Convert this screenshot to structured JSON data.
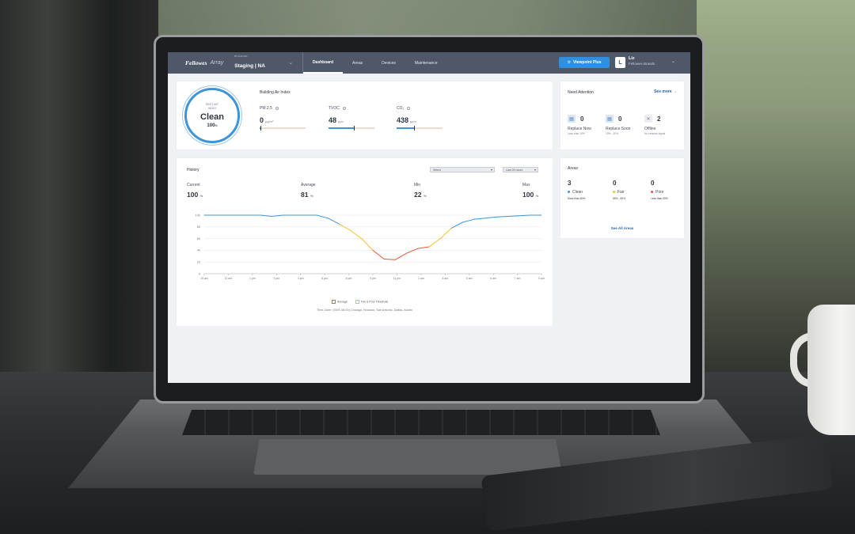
{
  "header": {
    "brand": "Fellowes",
    "brand_sub": "Array",
    "building_label": "BUILDING",
    "building_value": "Staging | NA",
    "nav": [
      "Dashboard",
      "Areas",
      "Devices",
      "Maintenance"
    ],
    "viewpoint_button": "Viewpoint Plus",
    "user_initial": "L",
    "user_name": "Liz",
    "user_company": "Fellowes Brands"
  },
  "air_index": {
    "ring_label": "BEST AIR INDEX",
    "status": "Clean",
    "percent": "100",
    "percent_unit": "%",
    "title": "Building Air Index",
    "metrics": [
      {
        "name": "PM 2.5",
        "value": "0",
        "unit": "μg/m³",
        "level": 0.02
      },
      {
        "name": "TVOC",
        "value": "48",
        "unit": "ppb",
        "level": 0.55
      },
      {
        "name": "CO₂",
        "value": "438",
        "unit": "ppm",
        "level": 0.38
      }
    ]
  },
  "attention": {
    "title": "Need Attention",
    "see_more": "See more →",
    "items": [
      {
        "count": "0",
        "label": "Replace Now",
        "sub": "Less than 10%"
      },
      {
        "count": "0",
        "label": "Replace Soon",
        "sub": "10% - 20%"
      },
      {
        "count": "2",
        "label": "Offline",
        "sub": "No network signal"
      }
    ]
  },
  "history": {
    "title": "History",
    "select": "Select",
    "range": "Last 24 hours",
    "stats": [
      {
        "label": "Current",
        "value": "100",
        "unit": "%"
      },
      {
        "label": "Average",
        "value": "81",
        "unit": "%"
      },
      {
        "label": "Min",
        "value": "22",
        "unit": "%"
      },
      {
        "label": "Max",
        "value": "100",
        "unit": "%"
      }
    ],
    "legend": [
      "Average",
      "Fair & Poor Threshold"
    ],
    "timezone": "Time Zone: (GMT-06:00) Chicago, Houston, San Antonio, Dallas, Austin"
  },
  "areas": {
    "title": "Areas",
    "items": [
      {
        "count": "3",
        "label": "Clean",
        "sub": "More than 80%",
        "color": "#3e94d6"
      },
      {
        "count": "0",
        "label": "Fair",
        "sub": "50% - 80%",
        "color": "#f2c12e"
      },
      {
        "count": "0",
        "label": "Poor",
        "sub": "Less than 50%",
        "color": "#e8553b"
      }
    ],
    "see_all": "See All Areas"
  },
  "chart_data": {
    "type": "line",
    "x": [
      "10 am",
      "11 am",
      "12 pm",
      "1 pm",
      "2 pm",
      "3 pm",
      "4 pm",
      "5 pm",
      "6 pm",
      "7 pm",
      "8 pm",
      "9 pm",
      "10 pm",
      "11 pm",
      "12 am",
      "1 am",
      "2 am",
      "3 am",
      "4 am",
      "5 am",
      "6 am",
      "7 am",
      "8 am",
      "9 am",
      "10 am"
    ],
    "x_ticks": [
      "10 am",
      "11 am",
      "1 pm",
      "3 pm",
      "4 pm",
      "6 pm",
      "8 pm",
      "9 pm",
      "11 pm",
      "1 am",
      "3 am",
      "5 am",
      "6 am",
      "7 am",
      "9 am"
    ],
    "y_ticks": [
      0,
      20,
      40,
      60,
      80,
      100
    ],
    "ylim": [
      0,
      100
    ],
    "series": [
      {
        "values": [
          100,
          100,
          100,
          100,
          100,
          100,
          98,
          100,
          100,
          100,
          100,
          95,
          85,
          74,
          60,
          40,
          25,
          24,
          35,
          43,
          46,
          60,
          78,
          88,
          93,
          95,
          97,
          98,
          99,
          100,
          100
        ]
      }
    ],
    "colors": {
      "good": "#3e94d6",
      "fair": "#f2c12e",
      "poor": "#e8553b"
    }
  }
}
